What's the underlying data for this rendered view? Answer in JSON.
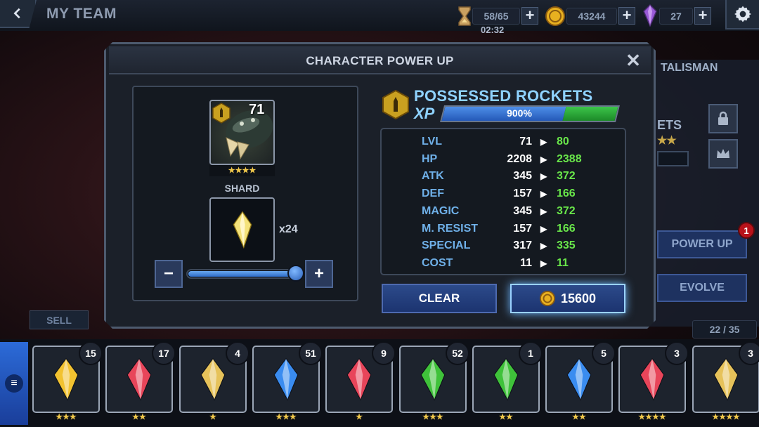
{
  "header": {
    "title": "MY TEAM",
    "energy": "58/65",
    "timer": "02:32",
    "coins": "43244",
    "gems": "27",
    "plus": "+"
  },
  "background": {
    "talisman_tab": "TALISMAN",
    "name_fragment": "ETS",
    "stars": "★★",
    "power_up": "POWER UP",
    "power_up_badge": "1",
    "evolve": "EVOLVE",
    "inventory_count": "22 / 35",
    "sell": "SELL"
  },
  "modal": {
    "title": "CHARACTER POWER UP",
    "close": "✕",
    "character": {
      "name": "POSSESSED ROCKETS",
      "level": "71",
      "stars": "★★★★"
    },
    "shard": {
      "label": "SHARD",
      "quantity": "x24",
      "slider_value": 1.0
    },
    "xp": {
      "label": "XP",
      "text": "900%",
      "fill_current": 0.7,
      "fill_gain": 0.3
    },
    "stats": [
      {
        "label": "LVL",
        "current": "71",
        "new": "80"
      },
      {
        "label": "HP",
        "current": "2208",
        "new": "2388"
      },
      {
        "label": "ATK",
        "current": "345",
        "new": "372"
      },
      {
        "label": "DEF",
        "current": "157",
        "new": "166"
      },
      {
        "label": "MAGIC",
        "current": "345",
        "new": "372"
      },
      {
        "label": "M. RESIST",
        "current": "157",
        "new": "166"
      },
      {
        "label": "SPECIAL",
        "current": "317",
        "new": "335"
      },
      {
        "label": "COST",
        "current": "11",
        "new": "11"
      }
    ],
    "clear_label": "CLEAR",
    "cost_value": "15600",
    "minus": "−",
    "plus": "+"
  },
  "inventory": [
    {
      "count": "15",
      "stars": "★★★",
      "color": "#f2c230"
    },
    {
      "count": "17",
      "stars": "★★",
      "color": "#e8455a"
    },
    {
      "count": "4",
      "stars": "★",
      "color": "#e6c25a"
    },
    {
      "count": "51",
      "stars": "★★★",
      "color": "#3a8cf0"
    },
    {
      "count": "9",
      "stars": "★",
      "color": "#e8455a"
    },
    {
      "count": "52",
      "stars": "★★★",
      "color": "#3fc23a"
    },
    {
      "count": "1",
      "stars": "★★",
      "color": "#3fc23a"
    },
    {
      "count": "5",
      "stars": "★★",
      "color": "#3a8cf0"
    },
    {
      "count": "3",
      "stars": "★★★★",
      "color": "#e8455a"
    },
    {
      "count": "3",
      "stars": "★★★★",
      "color": "#e6c25a"
    }
  ],
  "icons": {
    "back": "chevron-left-icon",
    "hourglass": "hourglass-icon",
    "coin": "coin-icon",
    "gem": "gem-icon",
    "settings": "gear-icon",
    "lock": "lock-icon",
    "crown": "crown-icon",
    "menu": "menu-icon"
  }
}
